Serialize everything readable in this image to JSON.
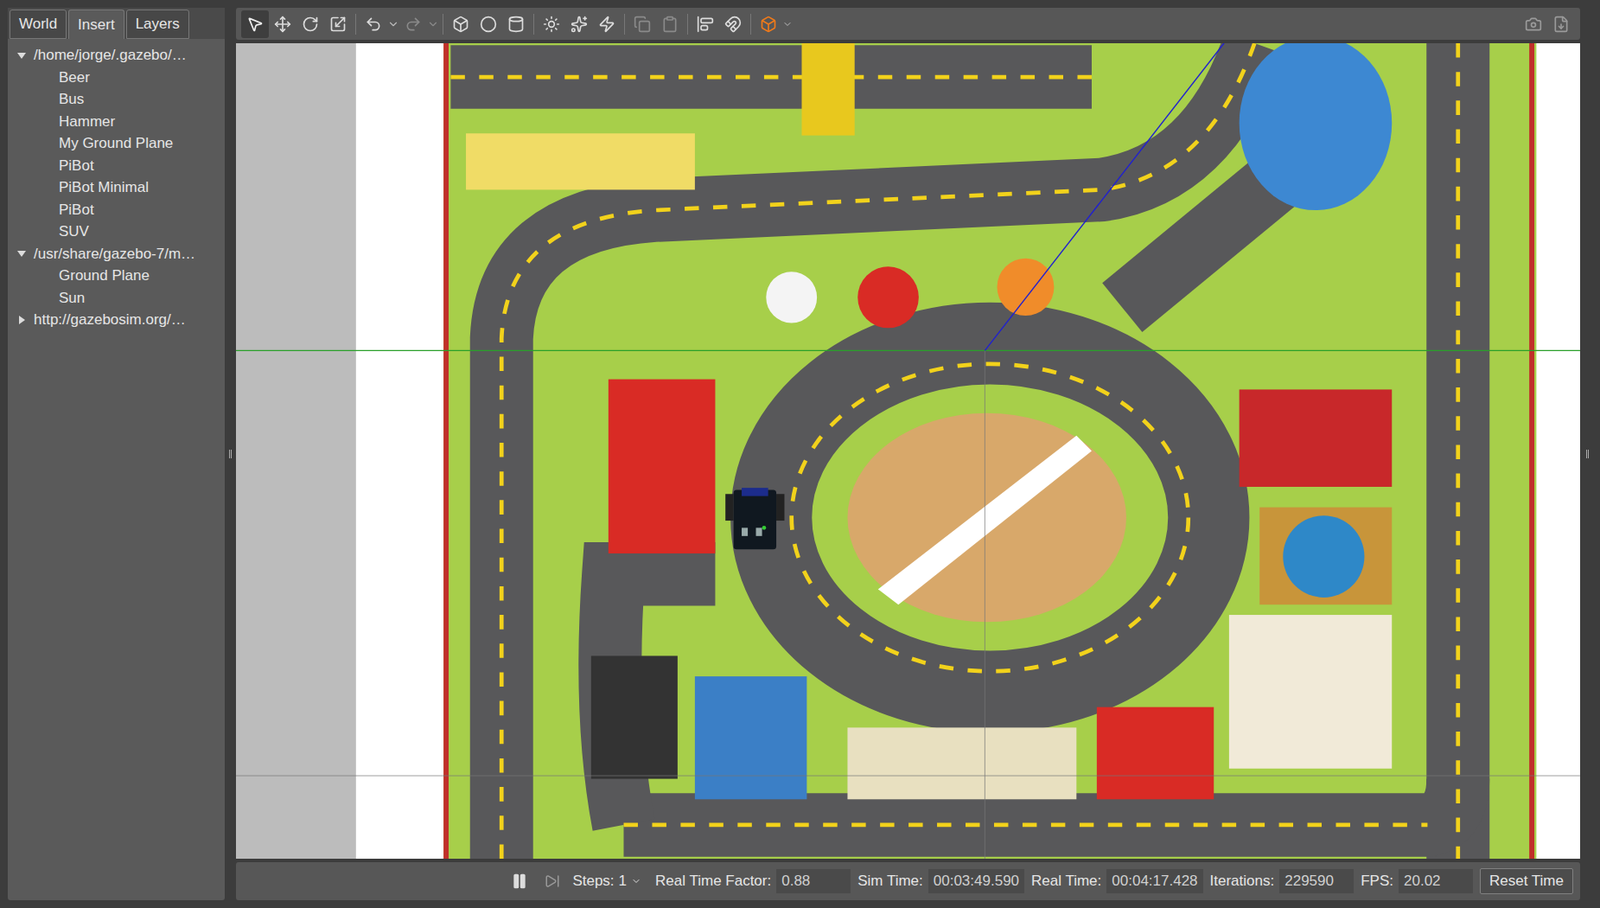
{
  "left_panel": {
    "tabs": [
      {
        "label": "World",
        "selected": false
      },
      {
        "label": "Insert",
        "selected": true
      },
      {
        "label": "Layers",
        "selected": false
      }
    ],
    "tree": [
      {
        "label": "/home/jorge/.gazebo/…",
        "expanded": true,
        "children": [
          "Beer",
          "Bus",
          "Hammer",
          "My Ground Plane",
          "PiBot",
          "PiBot Minimal",
          "PiBot",
          "SUV"
        ]
      },
      {
        "label": "/usr/share/gazebo-7/m…",
        "expanded": true,
        "children": [
          "Ground Plane",
          "Sun"
        ]
      },
      {
        "label": "http://gazebosim.org/…",
        "expanded": false,
        "children": []
      }
    ]
  },
  "status_bar": {
    "running": true,
    "steps_label": "Steps:",
    "steps_value": "1",
    "fields": [
      {
        "label": "Real Time Factor:",
        "value": "0.88"
      },
      {
        "label": "Sim Time:",
        "value": "00:03:49.590"
      },
      {
        "label": "Real Time:",
        "value": "00:04:17.428"
      },
      {
        "label": "Iterations:",
        "value": "229590"
      },
      {
        "label": "FPS:",
        "value": "20.02"
      }
    ],
    "button": "Reset Time"
  }
}
